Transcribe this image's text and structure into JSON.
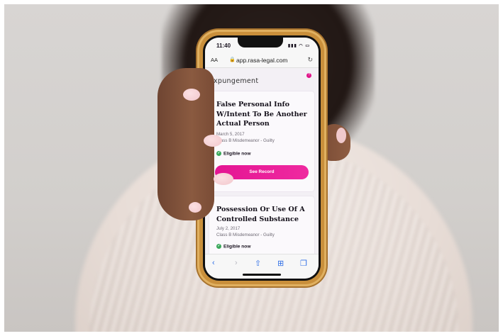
{
  "status_bar": {
    "time": "11:40"
  },
  "browser": {
    "text_size": "AA",
    "url": "app.rasa-legal.com"
  },
  "page": {
    "section_heading": "expungement",
    "records": [
      {
        "title": "False Personal Info W/Intent To Be Another Actual Person",
        "date": "March 5, 2017",
        "classification": "Class B Misdemeanor - Guilty",
        "status": "Eligible now",
        "button": "See Record"
      },
      {
        "title": "Possession Or Use Of A Controlled Substance",
        "date": "July 2, 2017",
        "classification": "Class B Misdemeanor - Guilty",
        "status": "Eligible now"
      }
    ]
  },
  "colors": {
    "accent": "#e41593",
    "eligible": "#3aa85a",
    "toolbar_icons": "#2e6ee6"
  },
  "icons": {
    "toolbar": [
      "back-icon",
      "forward-icon",
      "share-icon",
      "bookmarks-icon",
      "tabs-icon"
    ],
    "browser": [
      "lock-icon",
      "reload-icon"
    ]
  }
}
